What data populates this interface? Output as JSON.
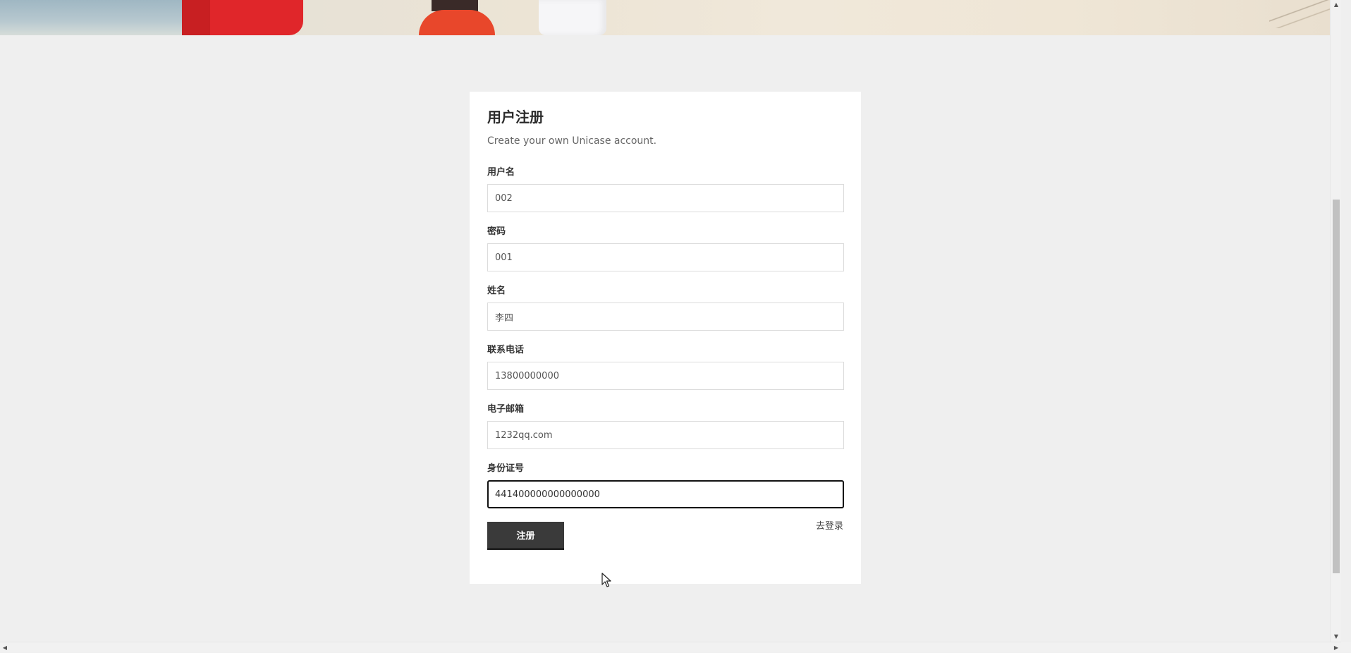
{
  "form": {
    "title": "用户注册",
    "subtitle": "Create your own Unicase account.",
    "fields": [
      {
        "label": "用户名",
        "value": "002"
      },
      {
        "label": "密码",
        "value": "001"
      },
      {
        "label": "姓名",
        "value": "李四"
      },
      {
        "label": "联系电话",
        "value": "13800000000"
      },
      {
        "label": "电子邮箱",
        "value": "1232qq.com"
      },
      {
        "label": "身份证号",
        "value": "441400000000000000"
      }
    ],
    "submit_label": "注册",
    "login_link": "去登录"
  },
  "icons": {
    "scroll_up": "▲",
    "scroll_down": "▼",
    "scroll_left": "◀",
    "scroll_right": "▶"
  },
  "colors": {
    "page_bg": "#efefef",
    "card_bg": "#ffffff",
    "button_bg": "#3a3a3a",
    "focus_border": "#111111"
  }
}
